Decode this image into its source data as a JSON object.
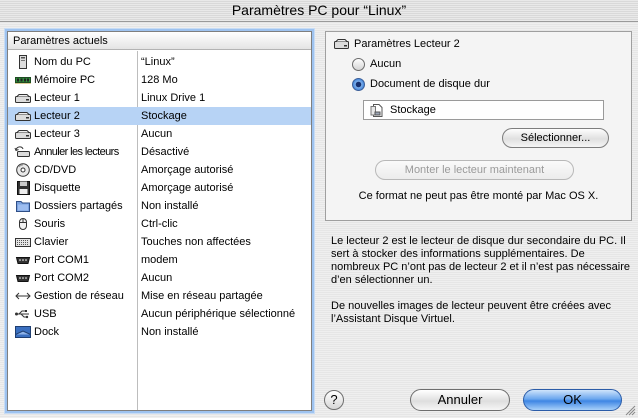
{
  "window": {
    "title": "Paramètres PC pour “Linux”"
  },
  "settings": {
    "header": "Paramètres actuels",
    "items": [
      {
        "name": "Nom du PC",
        "value": "“Linux”",
        "icon": "pc-tower-icon"
      },
      {
        "name": "Mémoire PC",
        "value": "128 Mo",
        "icon": "memory-chip-icon"
      },
      {
        "name": "Lecteur 1",
        "value": "Linux Drive 1",
        "icon": "hard-drive-icon"
      },
      {
        "name": "Lecteur 2",
        "value": "Stockage",
        "icon": "hard-drive-icon",
        "selected": true
      },
      {
        "name": "Lecteur 3",
        "value": "Aucun",
        "icon": "hard-drive-icon"
      },
      {
        "name": "Annuler les lecteurs",
        "value": "Désactivé",
        "icon": "undo-drives-icon"
      },
      {
        "name": "CD/DVD",
        "value": "Amorçage autorisé",
        "icon": "cd-dvd-icon"
      },
      {
        "name": "Disquette",
        "value": "Amorçage autorisé",
        "icon": "floppy-disk-icon"
      },
      {
        "name": "Dossiers partagés",
        "value": "Non installé",
        "icon": "shared-folder-icon"
      },
      {
        "name": "Souris",
        "value": "Ctrl-clic",
        "icon": "mouse-icon"
      },
      {
        "name": "Clavier",
        "value": "Touches non affectées",
        "icon": "keyboard-icon"
      },
      {
        "name": "Port COM1",
        "value": "modem",
        "icon": "serial-port-icon"
      },
      {
        "name": "Port COM2",
        "value": "Aucun",
        "icon": "serial-port-icon"
      },
      {
        "name": "Gestion de réseau",
        "value": "Mise en réseau partagée",
        "icon": "network-icon"
      },
      {
        "name": "USB",
        "value": "Aucun périphérique sélectionné",
        "icon": "usb-icon"
      },
      {
        "name": "Dock",
        "value": "Non installé",
        "icon": "dock-icon"
      }
    ]
  },
  "detail": {
    "title": "Paramètres Lecteur 2",
    "option_none": "Aucun",
    "option_hard_disk": "Document de disque dur",
    "selected_option": "Document de disque dur",
    "file_name": "Stockage",
    "select_button": "Sélectionner...",
    "mount_button": "Monter le lecteur maintenant",
    "mount_note": "Ce format ne peut pas être monté par Mac OS X."
  },
  "description": {
    "para1": "Le lecteur 2 est le lecteur de disque dur secondaire du PC. Il sert à stocker des informations supplémentaires. De nombreux PC n’ont pas de lecteur 2 et il n’est pas nécessaire d’en sélectionner un.",
    "para2": "De nouvelles images de lecteur peuvent être créées avec l’Assistant Disque Virtuel."
  },
  "footer": {
    "help": "?",
    "cancel": "Annuler",
    "ok": "OK"
  },
  "colors": {
    "selection": "#b7d3f5",
    "focus_ring": "#9ec3f0",
    "default_button": "#3e86e4"
  }
}
